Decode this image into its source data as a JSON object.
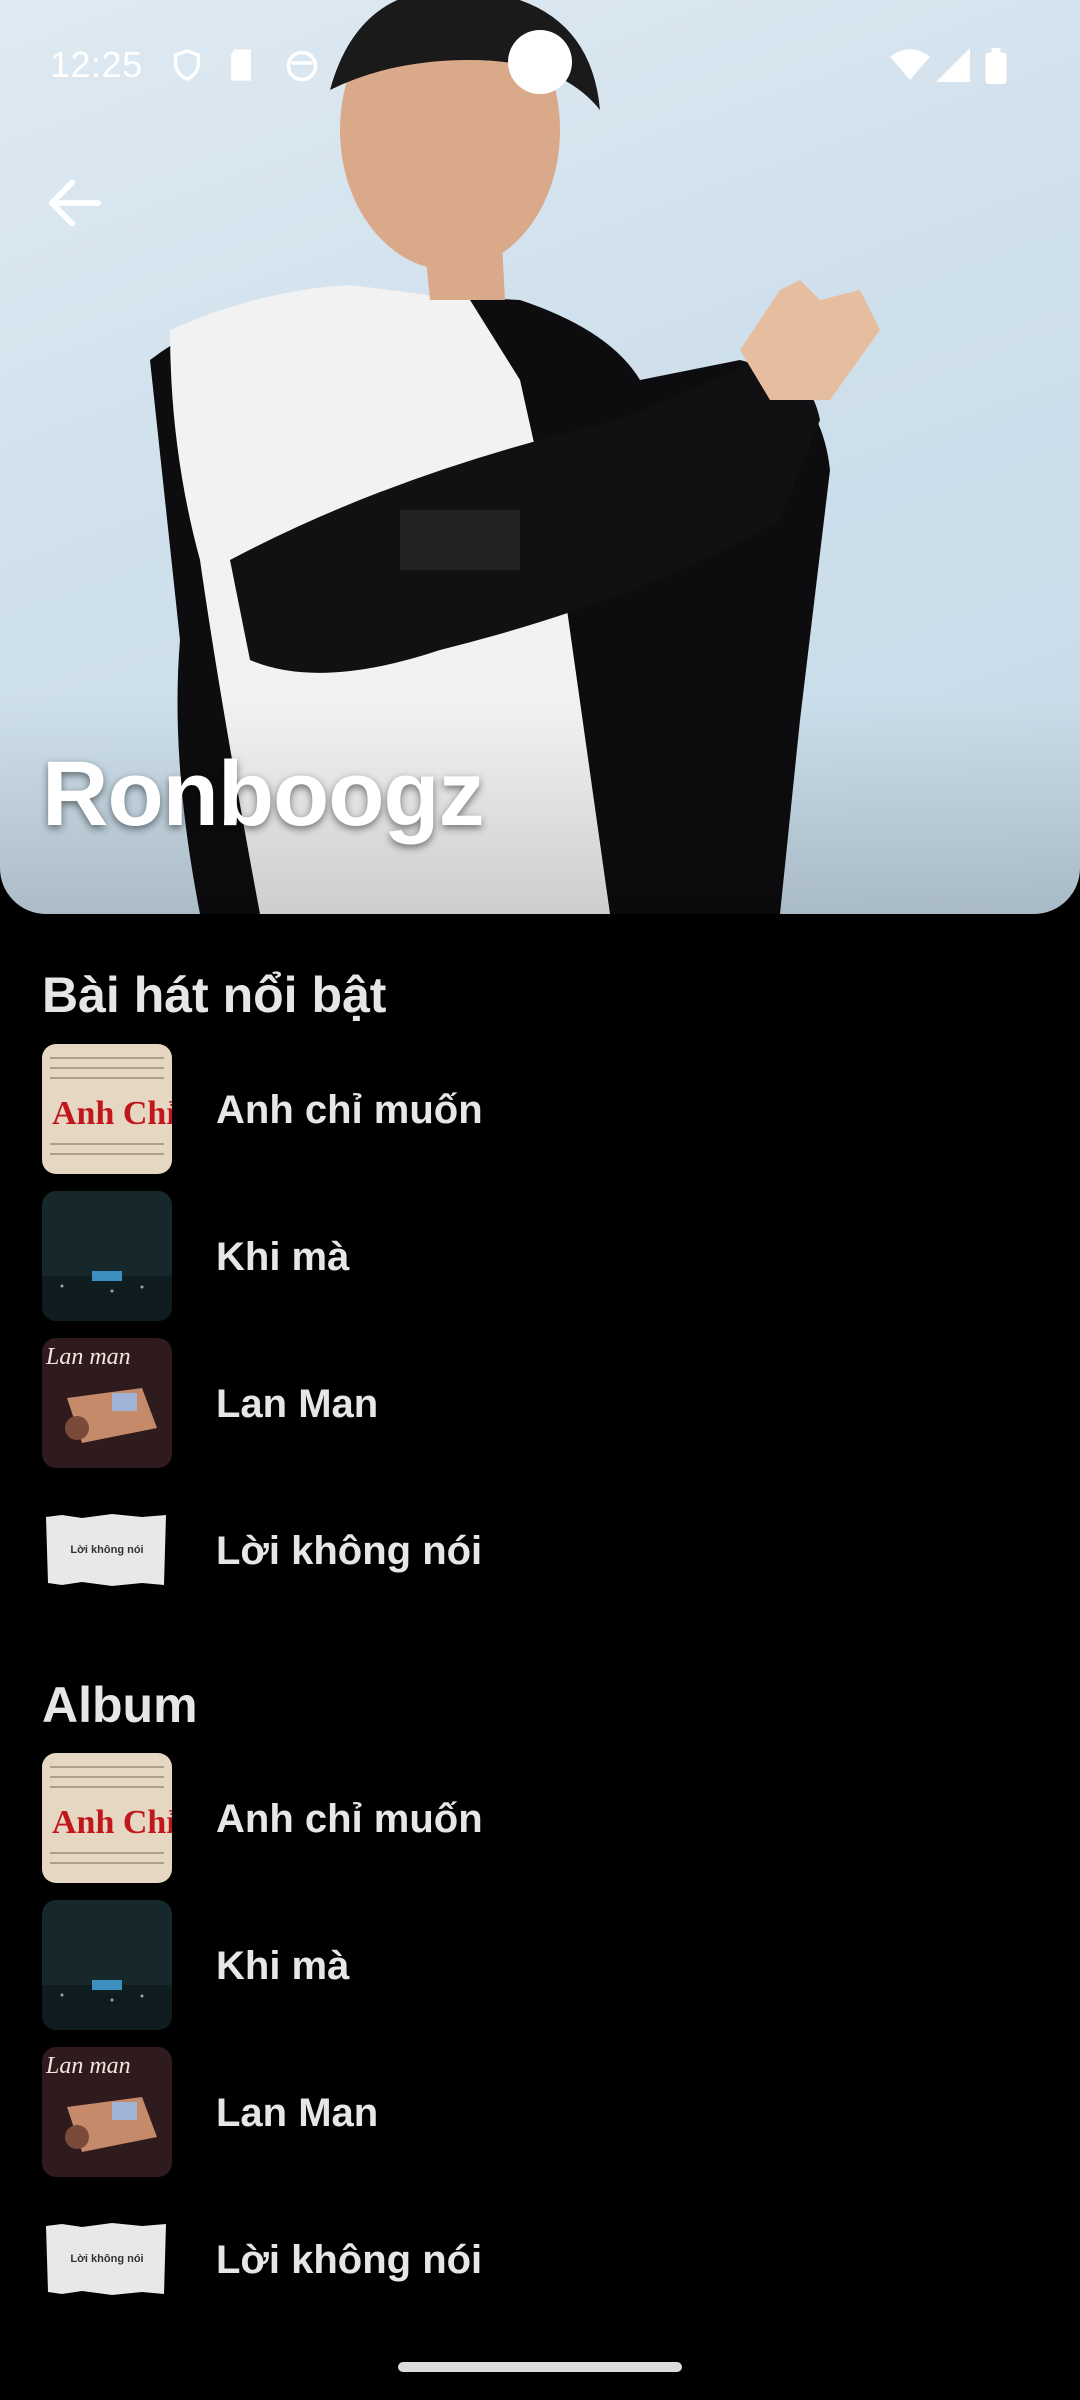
{
  "status_bar": {
    "time": "12:25"
  },
  "artist": {
    "name": "Ronboogz"
  },
  "sections": {
    "featured": {
      "title": "Bài hát nổi bật",
      "items": [
        {
          "label": "Anh chỉ muốn",
          "thumb_text": "Anh Chỉ Muốn"
        },
        {
          "label": "Khi mà"
        },
        {
          "label": "Lan Man",
          "thumb_text": "Lan man"
        },
        {
          "label": "Lời không nói",
          "thumb_text": "Lời không nói"
        }
      ]
    },
    "album": {
      "title": "Album",
      "items": [
        {
          "label": "Anh chỉ muốn",
          "thumb_text": "Anh Chỉ Muốn"
        },
        {
          "label": "Khi mà"
        },
        {
          "label": "Lan Man",
          "thumb_text": "Lan man"
        },
        {
          "label": "Lời không nói",
          "thumb_text": "Lời không nói"
        }
      ]
    }
  },
  "colors": {
    "background": "#000000",
    "text": "#e6e6e6",
    "hero_sky": "#cfe0ec"
  },
  "icons": [
    "back-arrow-icon",
    "shield-icon",
    "sd-card-icon",
    "face-icon",
    "wifi-icon",
    "signal-icon",
    "battery-icon"
  ]
}
